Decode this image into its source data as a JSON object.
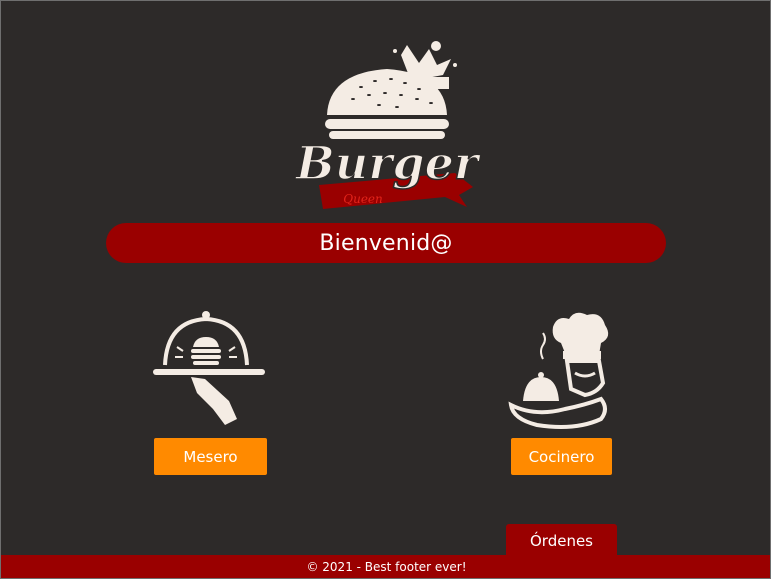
{
  "app": {
    "logo_title": "Burger",
    "logo_subtitle": "Queen"
  },
  "banner": {
    "text": "Bienvenid@"
  },
  "roles": {
    "waiter_label": "Mesero",
    "chef_label": "Cocinero",
    "waiter_icon": "waiter-cloche-icon",
    "chef_icon": "chef-hat-icon"
  },
  "orders_tab": {
    "label": "Órdenes"
  },
  "footer": {
    "text": "© 2021 - Best footer ever!"
  },
  "colors": {
    "background": "#2d2a29",
    "accent_red": "#9a0000",
    "button_orange": "#ff8a00",
    "cream": "#f4ece4"
  }
}
